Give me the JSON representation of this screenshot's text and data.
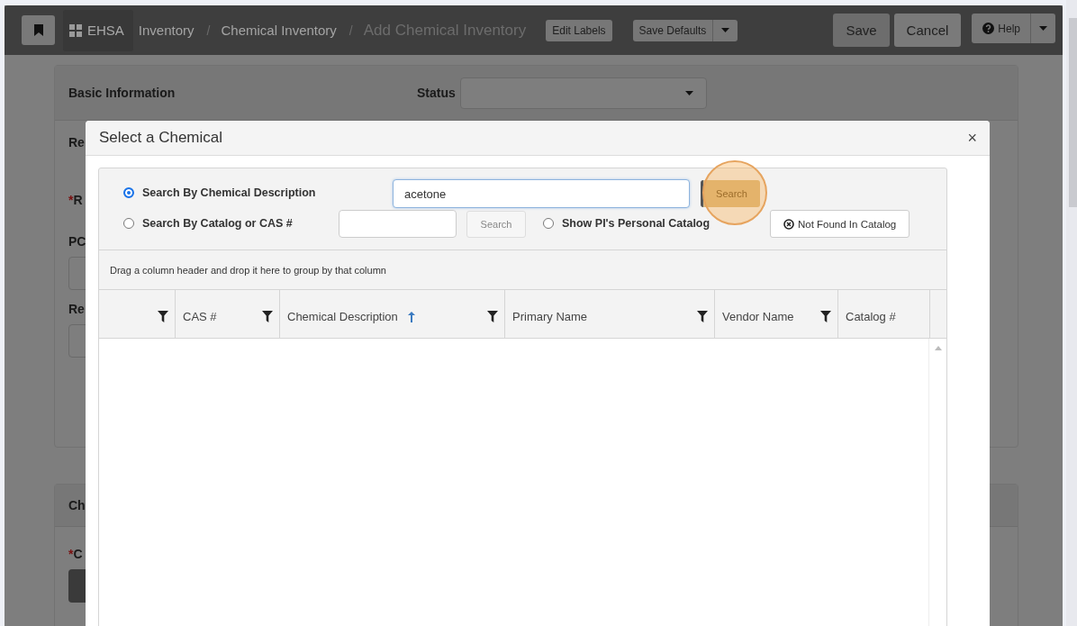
{
  "navbar": {
    "app_label": "EHSA",
    "breadcrumbs": [
      {
        "label": "Inventory",
        "current": false
      },
      {
        "label": "Chemical Inventory",
        "current": false
      },
      {
        "label": "Add Chemical Inventory",
        "current": true
      }
    ],
    "separators": [
      "/",
      "/"
    ],
    "tools": [
      {
        "label": "Edit Labels",
        "dropdown": false
      },
      {
        "label": "Save Defaults",
        "dropdown": true
      }
    ],
    "actions": [
      {
        "label": "Save",
        "primary": true
      },
      {
        "label": "Cancel",
        "primary": false
      }
    ],
    "help": {
      "label": "Help",
      "dropdown": true
    }
  },
  "page": {
    "panels": [
      {
        "title": "Basic Information",
        "status_label": "Status",
        "rows": [
          {
            "label": "Re",
            "kind": "heading"
          },
          {
            "required_mark": "*",
            "label": "R",
            "kind": "label"
          },
          {
            "label": "PC",
            "kind": "input"
          },
          {
            "label": "Re",
            "kind": "input"
          }
        ]
      },
      {
        "title": "Ch",
        "rows": [
          {
            "required_mark": "*",
            "label": "C",
            "kind": "button"
          }
        ]
      }
    ]
  },
  "modal": {
    "title": "Select a Chemical",
    "close": "×",
    "search_options": [
      {
        "label": "Search By Chemical Description",
        "selected": true,
        "input": {
          "value": "acetone",
          "focused": true
        },
        "button": {
          "label": "Search",
          "highlighted": true
        }
      },
      {
        "label": "Search By Catalog or CAS #",
        "selected": false,
        "input": {
          "focused": false
        },
        "button": {
          "label": "Search",
          "highlighted": false
        }
      }
    ],
    "personal_catalog": {
      "label": "Show PI's Personal Catalog",
      "selected": false
    },
    "not_found_button": "Not Found In Catalog",
    "group_hint": "Drag a column header and drop it here to group by that column",
    "columns": [
      {
        "filter": true,
        "sorted": false
      },
      {
        "label": "CAS #",
        "filter": true,
        "sorted": false
      },
      {
        "label": "Chemical Description",
        "filter": true,
        "sorted": true
      },
      {
        "label": "Primary Name",
        "filter": true,
        "sorted": false
      },
      {
        "label": "Vendor Name",
        "filter": true,
        "sorted": false
      },
      {
        "label": "Catalog #",
        "filter": false,
        "sorted": false
      }
    ]
  }
}
